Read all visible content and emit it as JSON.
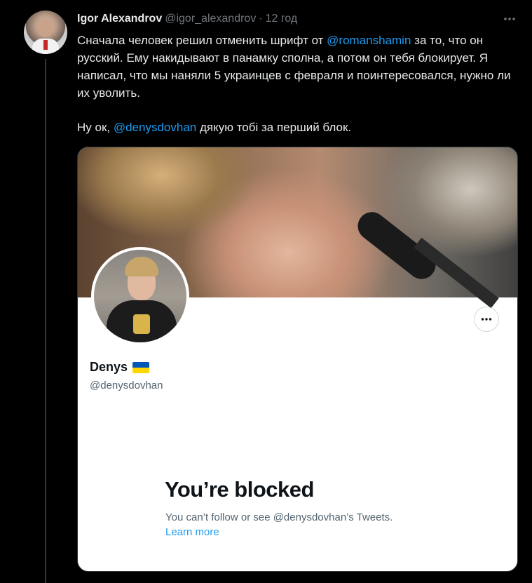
{
  "tweet": {
    "author": {
      "display_name": "Igor Alexandrov",
      "handle": "@igor_alexandrov",
      "separator": "·",
      "time": "12 год"
    },
    "more_icon": "more-horizontal-icon",
    "text": {
      "p1_before": "Сначала человек решил отменить шрифт от ",
      "p1_mention": "@romanshamin",
      "p1_after": " за то, что он русский. Ему накидывают в панамку сполна, а потом он тебя блокирует. Я написал, что мы наняли 5 украинцев с февраля и поинтересовался, нужно ли их уволить.",
      "p2_before": "Ну ок, ",
      "p2_mention": "@denysdovhan",
      "p2_after": " дякую тобі за перший блок."
    }
  },
  "profile_card": {
    "name": "Denys",
    "flag_icon": "ukraine-flag-icon",
    "handle": "@denysdovhan",
    "more_icon": "more-horizontal-icon",
    "blocked_title": "You’re blocked",
    "blocked_desc": "You can’t follow or see @denysdovhan’s Tweets.",
    "learn_more": "Learn more"
  },
  "colors": {
    "background": "#000000",
    "text_primary": "#e7e9ea",
    "text_secondary": "#71767b",
    "link": "#1d9bf0",
    "card_bg": "#ffffff",
    "card_text": "#0f1419",
    "card_text_secondary": "#536471"
  }
}
